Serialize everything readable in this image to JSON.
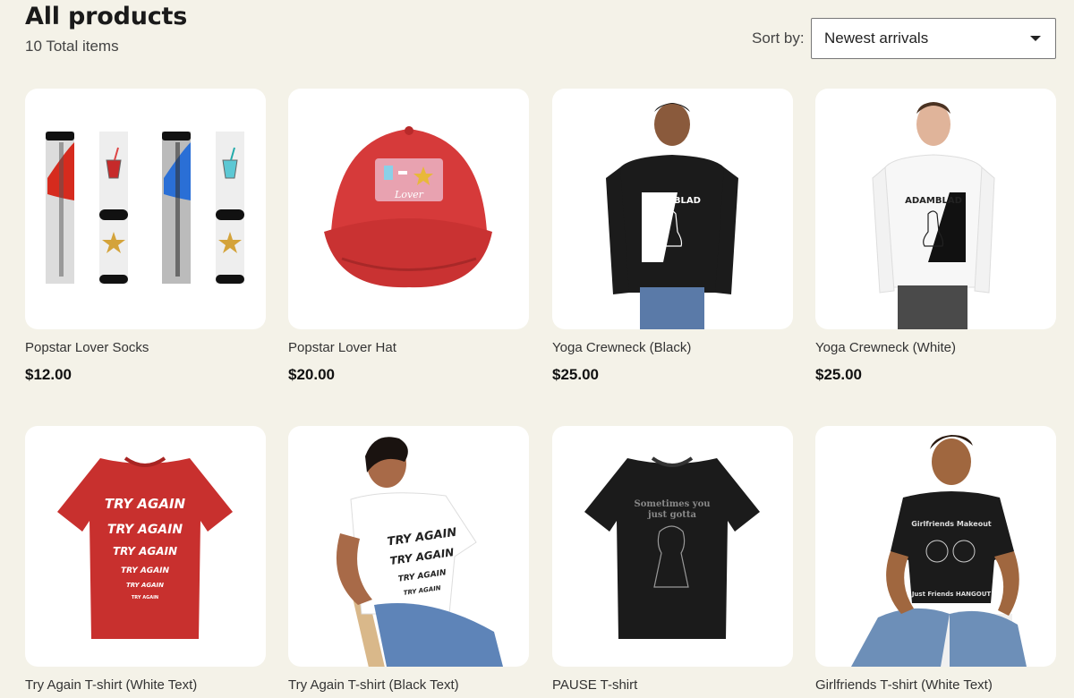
{
  "header": {
    "title": "All products",
    "count": "10 Total items",
    "sort_label": "Sort by:",
    "sort_value": "Newest arrivals"
  },
  "products": [
    {
      "name": "Popstar Lover Socks",
      "price": "$12.00",
      "image": "socks"
    },
    {
      "name": "Popstar Lover Hat",
      "price": "$20.00",
      "image": "hat"
    },
    {
      "name": "Yoga Crewneck (Black)",
      "price": "$25.00",
      "image": "crewneck-black",
      "print": "ADAMBLAD"
    },
    {
      "name": "Yoga Crewneck (White)",
      "price": "$25.00",
      "image": "crewneck-white",
      "print": "ADAMBLAD"
    },
    {
      "name": "Try Again T-shirt (White Text)",
      "price": "",
      "image": "tshirt-red",
      "print": "TRY AGAIN"
    },
    {
      "name": "Try Again T-shirt (Black Text)",
      "price": "",
      "image": "tshirt-white-model",
      "print": "TRY AGAIN"
    },
    {
      "name": "PAUSE T-shirt",
      "price": "",
      "image": "tshirt-black",
      "print_lines": [
        "Sometimes you",
        "just gotta"
      ]
    },
    {
      "name": "Girlfriends T-shirt (White Text)",
      "price": "",
      "image": "tshirt-black-model",
      "print_lines": [
        "Girlfriends Makeout",
        "Just Friends HANGOUT"
      ]
    }
  ],
  "colors": {
    "background": "#f4f2e8",
    "card": "#ffffff",
    "hat": "#d63a3a",
    "tshirt_red": "#c8302e",
    "black": "#1b1b1b"
  }
}
